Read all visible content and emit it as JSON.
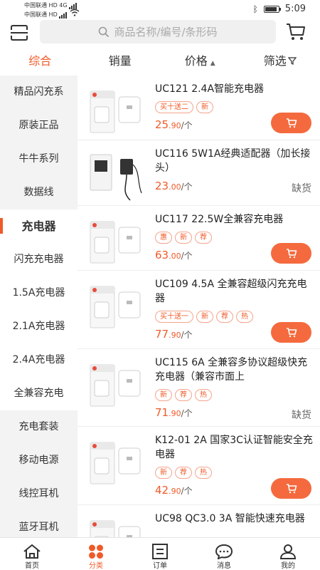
{
  "status_bar": {
    "carrier1": "中国联通",
    "carrier2": "中国联通",
    "hd": "HD",
    "net": "4G",
    "time": "5:09"
  },
  "header": {
    "search_placeholder": "商品名称/编号/条形码"
  },
  "sort_tabs": [
    {
      "label": "综合",
      "active": true
    },
    {
      "label": "销量"
    },
    {
      "label": "价格"
    },
    {
      "label": "筛选"
    }
  ],
  "sidebar": [
    {
      "label": "精品闪充系"
    },
    {
      "label": "原装正品"
    },
    {
      "label": "牛牛系列"
    },
    {
      "label": "数据线"
    },
    {
      "label": "充电器",
      "active": true
    },
    {
      "label": "闪充充电器"
    },
    {
      "label": "1.5A充电器"
    },
    {
      "label": "2.1A充电器"
    },
    {
      "label": "2.4A充电器"
    },
    {
      "label": "全兼容充电"
    },
    {
      "label": "充电套装"
    },
    {
      "label": "移动电源"
    },
    {
      "label": "线控耳机"
    },
    {
      "label": "蓝牙耳机"
    }
  ],
  "products": [
    {
      "name": "UC121 2.4A智能充电器",
      "tags": [
        "买十送二",
        "新"
      ],
      "price_int": "25",
      "price_dec": ".90",
      "unit": "/个",
      "in_stock": true
    },
    {
      "name": "UC116 5W1A经典适配器（加长接头）",
      "tags": [],
      "price_int": "23",
      "price_dec": ".00",
      "unit": "/个",
      "in_stock": false,
      "stock_label": "缺货"
    },
    {
      "name": "UC117 22.5W全兼容充电器",
      "tags": [
        "惠",
        "新",
        "荐"
      ],
      "price_int": "63",
      "price_dec": ".00",
      "unit": "/个",
      "in_stock": true
    },
    {
      "name": "UC109 4.5A 全兼容超级闪充充电器",
      "tags": [
        "买十送一",
        "新",
        "荐",
        "热"
      ],
      "price_int": "77",
      "price_dec": ".90",
      "unit": "/个",
      "in_stock": true
    },
    {
      "name": "UC115 6A 全兼容多协议超级快充充电器（兼容市面上",
      "tags": [
        "新",
        "荐",
        "热"
      ],
      "price_int": "71",
      "price_dec": ".90",
      "unit": "/个",
      "in_stock": false,
      "stock_label": "缺货"
    },
    {
      "name": "K12-01 2A 国家3C认证智能安全充电器",
      "tags": [
        "新",
        "荐",
        "热"
      ],
      "price_int": "42",
      "price_dec": ".90",
      "unit": "/个",
      "in_stock": true
    },
    {
      "name": "UC98  QC3.0 3A  智能快速充电器",
      "tags": [],
      "price_int": "",
      "price_dec": "",
      "unit": "",
      "in_stock": true
    }
  ],
  "bottom_nav": [
    {
      "label": "首页",
      "icon": "home-icon"
    },
    {
      "label": "分类",
      "icon": "category-icon",
      "active": true
    },
    {
      "label": "订单",
      "icon": "order-icon"
    },
    {
      "label": "消息",
      "icon": "message-icon"
    },
    {
      "label": "我的",
      "icon": "profile-icon"
    }
  ],
  "colors": {
    "accent": "#f05a28",
    "button": "#f46a3e"
  }
}
